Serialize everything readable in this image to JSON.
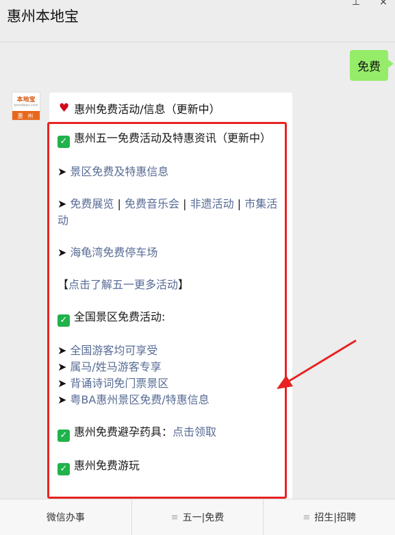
{
  "header": {
    "title": "惠州本地宝"
  },
  "chat": {
    "user_message": "免费",
    "avatar": {
      "line1": "本地宝",
      "line2": "bendibao.com",
      "city": "惠 州"
    },
    "reply_title": "惠州免费活动/信息（更新中）",
    "items": {
      "item1": "惠州五一免费活动及特惠资讯（更新中）",
      "item2": "景区免费及特惠信息",
      "item3_a": "免费展览",
      "item3_b": "免费音乐会",
      "item3_c": "非遗活动",
      "item3_d": "市集活动",
      "item4": "海龟湾免费停车场",
      "item5_link": "点击了解五一更多活动",
      "item6": "全国景区免费活动:",
      "item7": "全国游客均可享受",
      "item8": "属马/姓马游客专享",
      "item9": "背诵诗词免门票景区",
      "item10": "粤BA惠州景区免费/特惠信息",
      "item11_text": "惠州免费避孕药具：",
      "item11_link": "点击领取",
      "item12": "惠州免费游玩"
    }
  },
  "nav": {
    "item1": "微信办事",
    "item2": "五一|免费",
    "item3": "招生|招聘"
  },
  "colors": {
    "accent_green": "#95ec69",
    "link": "#576b95",
    "annotation_red": "#e82222"
  }
}
